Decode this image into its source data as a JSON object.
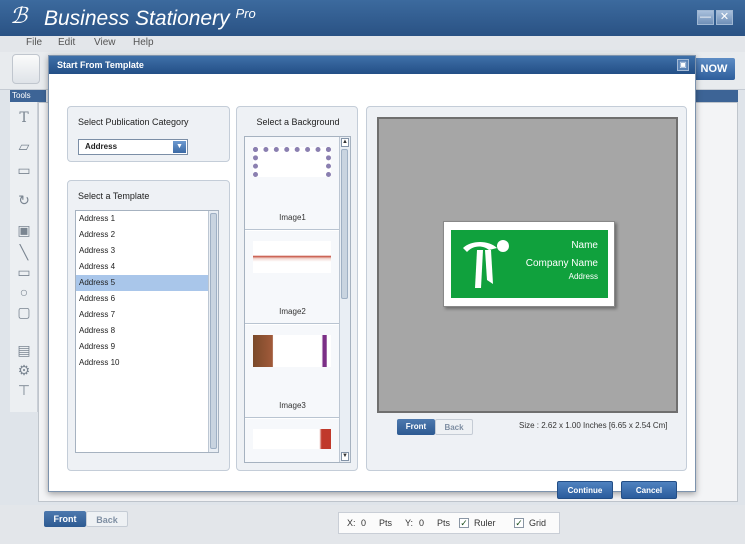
{
  "app": {
    "name": "Business Stationery",
    "name_suffix": "Pro",
    "logo_glyph": "ℬ"
  },
  "window_controls": {
    "minimize": "—",
    "close": "✕"
  },
  "menu": [
    "File",
    "Edit",
    "View",
    "Help"
  ],
  "toolbar": {
    "now_label": "NOW"
  },
  "tools": {
    "header": "Tools"
  },
  "dialog": {
    "title": "Start From Template",
    "close_glyph": "▣",
    "category": {
      "title": "Select Publication Category",
      "selected": "Address"
    },
    "templates": {
      "title": "Select a Template",
      "items": [
        "Address 1",
        "Address 2",
        "Address 3",
        "Address 4",
        "Address 5",
        "Address 6",
        "Address 7",
        "Address 8",
        "Address 9",
        "Address 10"
      ],
      "selected_index": 4
    },
    "backgrounds": {
      "title": "Select a Background",
      "items": [
        "Image1",
        "Image2",
        "Image3"
      ]
    },
    "preview": {
      "card": {
        "name": "Name",
        "company": "Company Name",
        "address": "Address",
        "color": "#10a13d"
      },
      "front_label": "Front",
      "back_label": "Back",
      "size_text": "Size : 2.62 x 1.00 Inches [6.65 x 2.54 Cm]"
    },
    "continue_label": "Continue",
    "cancel_label": "Cancel"
  },
  "bottom": {
    "front_label": "Front",
    "back_label": "Back",
    "x_label": "X:",
    "x_value": "0",
    "x_unit": "Pts",
    "y_label": "Y:",
    "y_value": "0",
    "y_unit": "Pts",
    "ruler_label": "Ruler",
    "grid_label": "Grid",
    "ruler_checked": true,
    "grid_checked": true
  }
}
